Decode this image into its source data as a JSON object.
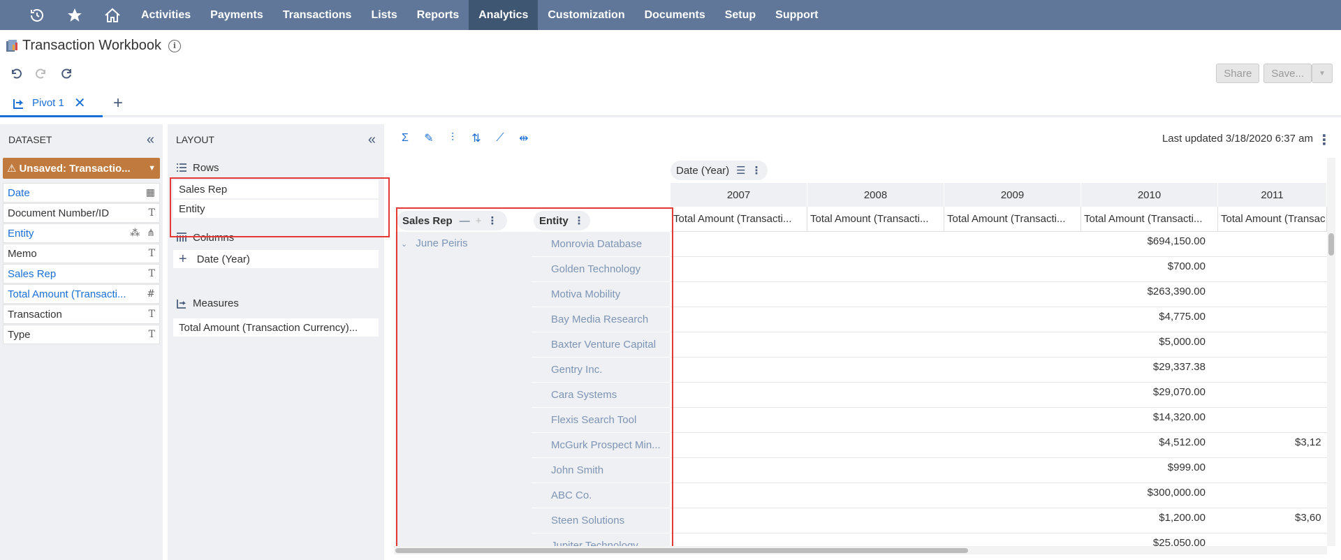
{
  "nav": {
    "items": [
      "Activities",
      "Payments",
      "Transactions",
      "Lists",
      "Reports",
      "Analytics",
      "Customization",
      "Documents",
      "Setup",
      "Support"
    ],
    "active": "Analytics"
  },
  "header": {
    "title": "Transaction Workbook"
  },
  "actions": {
    "share": "Share",
    "save": "Save..."
  },
  "tabs": [
    {
      "label": "Pivot 1"
    }
  ],
  "dataset": {
    "title": "DATASET",
    "selected": "Unsaved: Transactio...",
    "fields": [
      {
        "label": "Date",
        "icon": "calendar-icon"
      },
      {
        "label": "Document Number/ID",
        "icon": "text-icon"
      },
      {
        "label": "Entity",
        "icon": "join-icon"
      },
      {
        "label": "Memo",
        "icon": "text-icon"
      },
      {
        "label": "Sales Rep",
        "icon": "text-icon"
      },
      {
        "label": "Total Amount (Transacti...",
        "icon": "number-icon"
      },
      {
        "label": "Transaction",
        "icon": "text-icon"
      },
      {
        "label": "Type",
        "icon": "text-icon"
      }
    ]
  },
  "layout": {
    "title": "LAYOUT",
    "rows_title": "Rows",
    "rows": [
      "Sales Rep",
      "Entity"
    ],
    "columns_title": "Columns",
    "columns": [
      "Date  (Year)"
    ],
    "measures_title": "Measures",
    "measures": [
      "Total Amount (Transaction Currency)..."
    ]
  },
  "pivot": {
    "last_updated_label": "Last updated",
    "last_updated_value": "3/18/2020 6:37 am",
    "column_chip": "Date (Year)",
    "row_chip_1": "Sales Rep",
    "row_chip_2": "Entity",
    "years": [
      "2007",
      "2008",
      "2009",
      "2010",
      "2011"
    ],
    "measure_header": "Total Amount (Transacti...",
    "measure_header_partial": "Total Amount (Transac",
    "sales_rep": "June Peiris",
    "rows": [
      {
        "entity": "Monrovia Database",
        "v2010": "$694,150.00",
        "v2011": ""
      },
      {
        "entity": "Golden Technology",
        "v2010": "$700.00",
        "v2011": ""
      },
      {
        "entity": "Motiva Mobility",
        "v2010": "$263,390.00",
        "v2011": ""
      },
      {
        "entity": "Bay Media Research",
        "v2010": "$4,775.00",
        "v2011": ""
      },
      {
        "entity": "Baxter Venture Capital",
        "v2010": "$5,000.00",
        "v2011": ""
      },
      {
        "entity": "Gentry Inc.",
        "v2010": "$29,337.38",
        "v2011": ""
      },
      {
        "entity": "Cara Systems",
        "v2010": "$29,070.00",
        "v2011": ""
      },
      {
        "entity": "Flexis Search Tool",
        "v2010": "$14,320.00",
        "v2011": ""
      },
      {
        "entity": "McGurk Prospect Min...",
        "v2010": "$4,512.00",
        "v2011": "$3,12"
      },
      {
        "entity": "John Smith",
        "v2010": "$999.00",
        "v2011": ""
      },
      {
        "entity": "ABC Co.",
        "v2010": "$300,000.00",
        "v2011": ""
      },
      {
        "entity": "Steen Solutions",
        "v2010": "$1,200.00",
        "v2011": "$3,60"
      },
      {
        "entity": "Jupiter Technology",
        "v2010": "$25,050.00",
        "v2011": ""
      }
    ]
  }
}
